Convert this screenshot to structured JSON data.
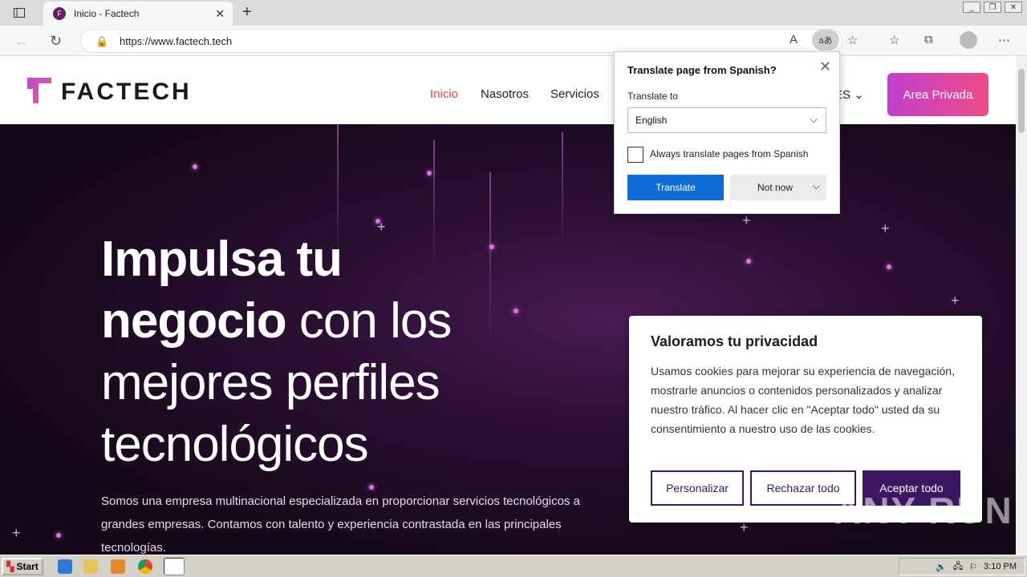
{
  "browser": {
    "tab_title": "Inicio - Factech",
    "url": "https://www.factech.tech",
    "translate_icon": "aあ"
  },
  "site": {
    "logo_text": "FACTECH",
    "nav": [
      "Inicio",
      "Nasotros",
      "Servicios"
    ],
    "lang_suffix": "ES",
    "area_button": "Area Privada"
  },
  "hero": {
    "title_bold_1": "Impulsa tu",
    "title_bold_2": "negocio",
    "title_rest_1": " con los",
    "title_line_3": "mejores perfiles",
    "title_line_4": "tecnológicos",
    "subtitle": "Somos una empresa multinacional especializada en proporcionar servicios tecnológicos a grandes empresas. Contamos con talento y experiencia contrastada en las principales tecnologías."
  },
  "translate_popup": {
    "title": "Translate page from Spanish?",
    "label": "Translate to",
    "selected_language": "English",
    "checkbox_label": "Always translate pages from Spanish",
    "translate_button": "Translate",
    "not_now_button": "Not now"
  },
  "cookie": {
    "title": "Valoramos tu privacidad",
    "body": "Usamos cookies para mejorar su experiencia de navegación, mostrarle anuncios o contenidos personalizados y analizar nuestro tráfico. Al hacer clic en \"Aceptar todo\" usted da su consentimiento a nuestro uso de las cookies.",
    "btn_customize": "Personalizar",
    "btn_reject": "Rechazar todo",
    "btn_accept": "Aceptar todo"
  },
  "taskbar": {
    "start": "Start",
    "clock": "3:10 PM"
  },
  "watermark": "ANY RUN"
}
